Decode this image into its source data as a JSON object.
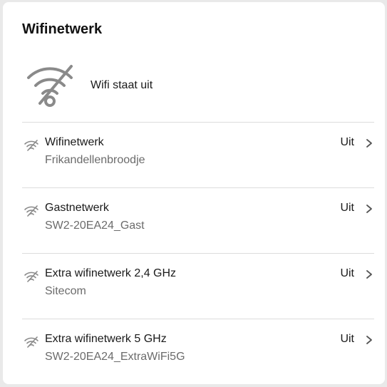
{
  "panel": {
    "title": "Wifinetwerk",
    "status_icon": "wifi-off-icon",
    "status_text": "Wifi staat uit"
  },
  "networks": [
    {
      "name": "Wifinetwerk",
      "ssid": "Frikandellenbroodje",
      "state": "Uit",
      "icon": "wifi-off-icon"
    },
    {
      "name": "Gastnetwerk",
      "ssid": "SW2-20EA24_Gast",
      "state": "Uit",
      "icon": "wifi-off-icon"
    },
    {
      "name": "Extra wifinetwerk 2,4 GHz",
      "ssid": "Sitecom",
      "state": "Uit",
      "icon": "wifi-off-icon"
    },
    {
      "name": "Extra wifinetwerk 5 GHz",
      "ssid": "SW2-20EA24_ExtraWiFi5G",
      "state": "Uit",
      "icon": "wifi-off-icon"
    }
  ],
  "colors": {
    "icon_gray": "#8a8a8a",
    "divider": "#dcdcdc",
    "secondary_text": "#6b6b6b"
  }
}
